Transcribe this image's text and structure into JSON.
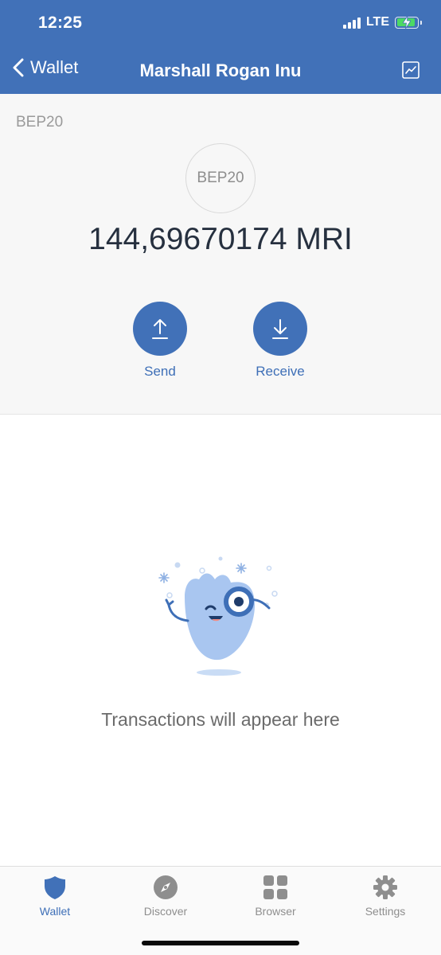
{
  "status_bar": {
    "time": "12:25",
    "network": "LTE"
  },
  "nav": {
    "back_label": "Wallet",
    "title": "Marshall Rogan Inu"
  },
  "token": {
    "network_label": "BEP20",
    "icon_text": "BEP20",
    "balance": "144,69670174 MRI"
  },
  "actions": {
    "send_label": "Send",
    "receive_label": "Receive"
  },
  "empty_state": {
    "message": "Transactions will appear here"
  },
  "tabs": [
    {
      "label": "Wallet",
      "icon": "shield-icon",
      "active": true
    },
    {
      "label": "Discover",
      "icon": "compass-icon",
      "active": false
    },
    {
      "label": "Browser",
      "icon": "grid-icon",
      "active": false
    },
    {
      "label": "Settings",
      "icon": "gear-icon",
      "active": false
    }
  ],
  "colors": {
    "brand": "#4171b8",
    "accent_text": "#3e6fb7",
    "inactive_tab": "#8e8e8e",
    "battery_green": "#4cd964"
  }
}
